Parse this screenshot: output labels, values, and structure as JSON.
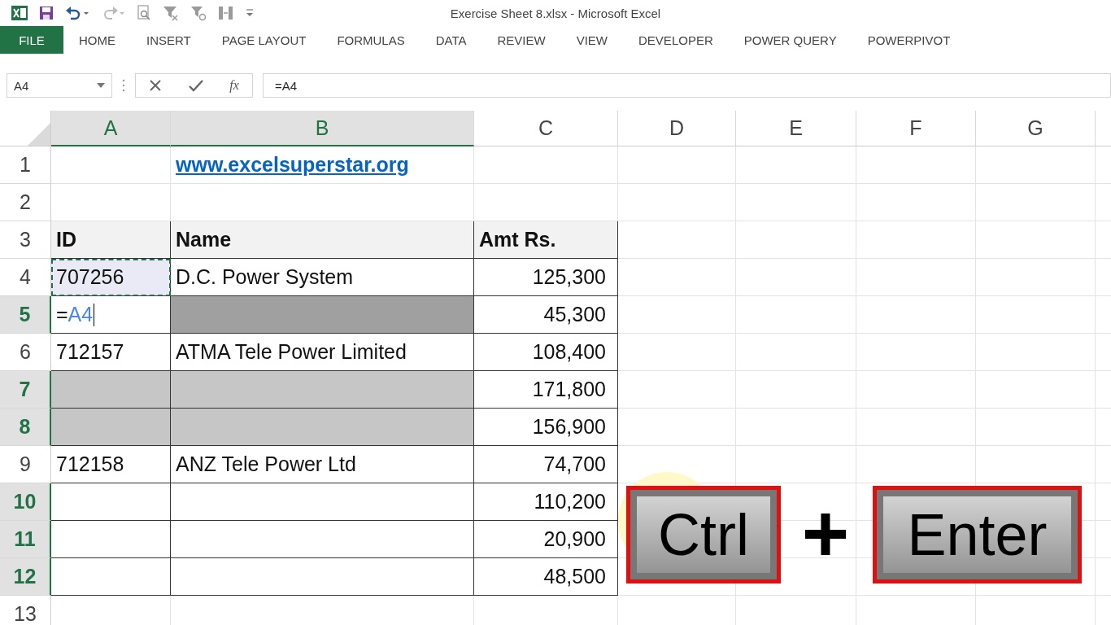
{
  "window": {
    "title": "Exercise Sheet 8.xlsx - Microsoft Excel"
  },
  "ribbon_tabs": [
    {
      "label": "FILE",
      "selected": true
    },
    {
      "label": "HOME",
      "selected": false
    },
    {
      "label": "INSERT",
      "selected": false
    },
    {
      "label": "PAGE LAYOUT",
      "selected": false
    },
    {
      "label": "FORMULAS",
      "selected": false
    },
    {
      "label": "DATA",
      "selected": false
    },
    {
      "label": "REVIEW",
      "selected": false
    },
    {
      "label": "VIEW",
      "selected": false
    },
    {
      "label": "DEVELOPER",
      "selected": false
    },
    {
      "label": "POWER QUERY",
      "selected": false
    },
    {
      "label": "POWERPIVOT",
      "selected": false
    }
  ],
  "formula_bar": {
    "name_box": "A4",
    "function_label": "fx",
    "formula": "=A4"
  },
  "columns": [
    {
      "label": "A",
      "selected": true
    },
    {
      "label": "B",
      "selected": true
    },
    {
      "label": "C",
      "selected": false
    },
    {
      "label": "D",
      "selected": false
    },
    {
      "label": "E",
      "selected": false
    },
    {
      "label": "F",
      "selected": false
    },
    {
      "label": "G",
      "selected": false
    }
  ],
  "rows": [
    {
      "label": "1",
      "selected": false,
      "cells": [
        {
          "kind": "empty",
          "bordered": false,
          "selected": false
        },
        {
          "kind": "link",
          "text": "www.excelsuperstar.org",
          "bordered": false,
          "selected": false
        },
        {
          "kind": "empty",
          "bordered": false,
          "selected": false
        }
      ]
    },
    {
      "label": "2",
      "selected": false,
      "cells": [
        {
          "kind": "empty",
          "bordered": false,
          "selected": false
        },
        {
          "kind": "empty",
          "bordered": false,
          "selected": false
        },
        {
          "kind": "empty",
          "bordered": false,
          "selected": false
        }
      ]
    },
    {
      "label": "3",
      "selected": false,
      "cells": [
        {
          "kind": "header",
          "text": "ID",
          "bordered": true,
          "selected": false
        },
        {
          "kind": "header",
          "text": "Name",
          "bordered": true,
          "selected": false
        },
        {
          "kind": "header",
          "text": "Amt Rs.",
          "bordered": true,
          "selected": false
        }
      ]
    },
    {
      "label": "4",
      "selected": false,
      "cells": [
        {
          "kind": "text",
          "text": "707256",
          "bordered": true,
          "selected": false,
          "copy_source": true
        },
        {
          "kind": "text",
          "text": "D.C. Power System",
          "bordered": true,
          "selected": false
        },
        {
          "kind": "number",
          "text": "125,300",
          "bordered": true,
          "selected": false
        }
      ]
    },
    {
      "label": "5",
      "selected": true,
      "cells": [
        {
          "kind": "edit",
          "text": "=",
          "ref": "A4",
          "bordered": true,
          "selected": false
        },
        {
          "kind": "empty",
          "bordered": true,
          "selected": true
        },
        {
          "kind": "number",
          "text": "45,300",
          "bordered": true,
          "selected": false
        }
      ]
    },
    {
      "label": "6",
      "selected": false,
      "cells": [
        {
          "kind": "text",
          "text": "712157",
          "bordered": true,
          "selected": false
        },
        {
          "kind": "text",
          "text": "ATMA Tele Power Limited",
          "bordered": true,
          "selected": false
        },
        {
          "kind": "number",
          "text": "108,400",
          "bordered": true,
          "selected": false
        }
      ]
    },
    {
      "label": "7",
      "selected": true,
      "cells": [
        {
          "kind": "empty",
          "bordered": true,
          "selected": true
        },
        {
          "kind": "empty",
          "bordered": true,
          "selected": true
        },
        {
          "kind": "number",
          "text": "171,800",
          "bordered": true,
          "selected": false
        }
      ]
    },
    {
      "label": "8",
      "selected": true,
      "cells": [
        {
          "kind": "empty",
          "bordered": true,
          "selected": true
        },
        {
          "kind": "empty",
          "bordered": true,
          "selected": true
        },
        {
          "kind": "number",
          "text": "156,900",
          "bordered": true,
          "selected": false
        }
      ]
    },
    {
      "label": "9",
      "selected": false,
      "cells": [
        {
          "kind": "text",
          "text": "712158",
          "bordered": true,
          "selected": false
        },
        {
          "kind": "text",
          "text": "ANZ Tele Power Ltd",
          "bordered": true,
          "selected": false
        },
        {
          "kind": "number",
          "text": "74,700",
          "bordered": true,
          "selected": false
        }
      ]
    },
    {
      "label": "10",
      "selected": true,
      "cells": [
        {
          "kind": "empty",
          "bordered": true,
          "selected": false
        },
        {
          "kind": "empty",
          "bordered": true,
          "selected": false
        },
        {
          "kind": "number",
          "text": "110,200",
          "bordered": true,
          "selected": false
        }
      ]
    },
    {
      "label": "11",
      "selected": true,
      "cells": [
        {
          "kind": "empty",
          "bordered": true,
          "selected": false
        },
        {
          "kind": "empty",
          "bordered": true,
          "selected": false
        },
        {
          "kind": "number",
          "text": "20,900",
          "bordered": true,
          "selected": false
        }
      ]
    },
    {
      "label": "12",
      "selected": true,
      "cells": [
        {
          "kind": "empty",
          "bordered": true,
          "selected": false
        },
        {
          "kind": "empty",
          "bordered": true,
          "selected": false
        },
        {
          "kind": "number",
          "text": "48,500",
          "bordered": true,
          "selected": false
        }
      ]
    },
    {
      "label": "13",
      "selected": false,
      "cells": [
        {
          "kind": "empty",
          "bordered": false,
          "selected": false
        },
        {
          "kind": "empty",
          "bordered": false,
          "selected": false
        },
        {
          "kind": "empty",
          "bordered": false,
          "selected": false
        }
      ]
    }
  ],
  "shortcut": {
    "keys": [
      "Ctrl",
      "Enter"
    ],
    "joiner": "+"
  }
}
